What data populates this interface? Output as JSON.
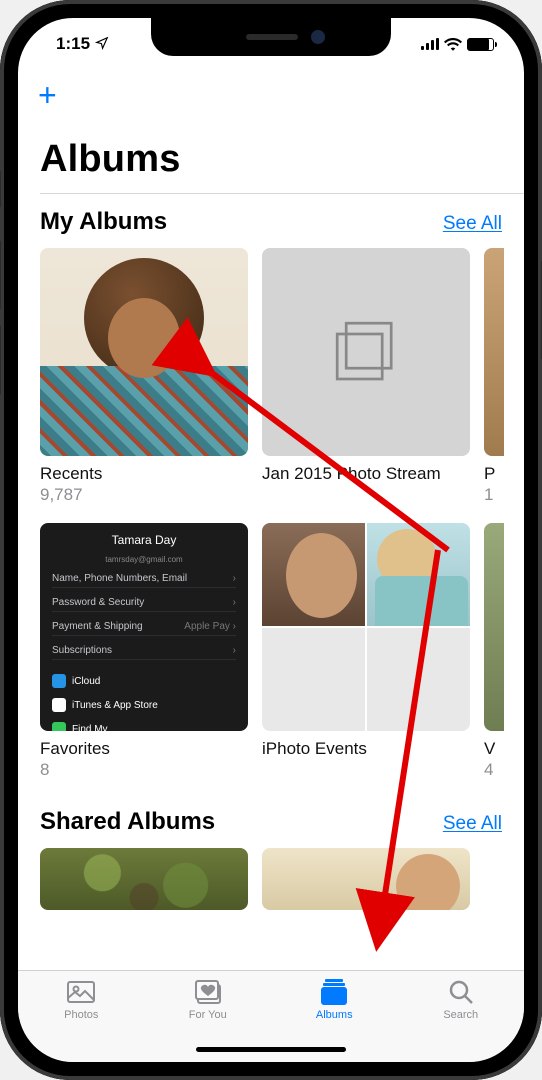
{
  "status": {
    "time": "1:15",
    "location_glyph": "✈︎"
  },
  "nav": {
    "add_glyph": "+"
  },
  "page_title": "Albums",
  "sections": {
    "my_albums": {
      "title": "My Albums",
      "see_all": "See All",
      "row1": [
        {
          "name": "Recents",
          "count": "9,787"
        },
        {
          "name": "Jan 2015 Photo Stream",
          "count": ""
        },
        {
          "name": "P",
          "count": "1"
        }
      ],
      "row2": [
        {
          "name": "Favorites",
          "count": "8"
        },
        {
          "name": "iPhoto Events",
          "count": ""
        },
        {
          "name": "V",
          "count": "4"
        }
      ],
      "favorites_thumb": {
        "title": "Tamara Day",
        "subtitle": "tamrsday@gmail.com",
        "rows": [
          [
            "Name, Phone Numbers, Email",
            "›"
          ],
          [
            "Password & Security",
            "›"
          ],
          [
            "Payment & Shipping",
            "Apple Pay ›"
          ],
          [
            "Subscriptions",
            "›"
          ]
        ],
        "apps": [
          "iCloud",
          "iTunes & App Store",
          "Find My"
        ]
      }
    },
    "shared_albums": {
      "title": "Shared Albums",
      "see_all": "See All"
    }
  },
  "tabs": [
    {
      "key": "photos",
      "label": "Photos"
    },
    {
      "key": "foryou",
      "label": "For You"
    },
    {
      "key": "albums",
      "label": "Albums"
    },
    {
      "key": "search",
      "label": "Search"
    }
  ],
  "active_tab": "albums"
}
